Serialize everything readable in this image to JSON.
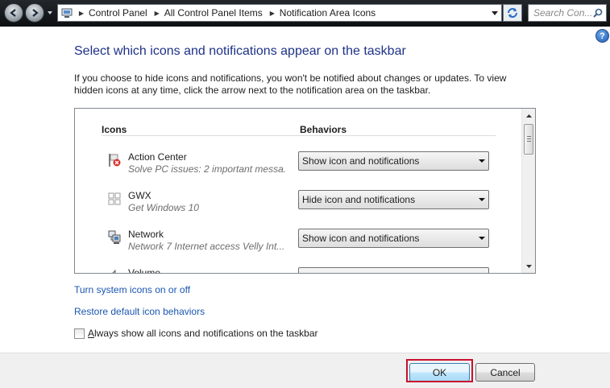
{
  "address_bar": {
    "breadcrumbs": [
      "Control Panel",
      "All Control Panel Items",
      "Notification Area Icons"
    ],
    "search_placeholder": "Search Con...",
    "icons": [
      "back-arrow-icon",
      "forward-arrow-icon",
      "control-panel-icon",
      "refresh-icon",
      "search-icon"
    ]
  },
  "help_label": "?",
  "page": {
    "title": "Select which icons and notifications appear on the taskbar",
    "description": "If you choose to hide icons and notifications, you won't be notified about changes or updates. To view hidden icons at any time, click the arrow next to the notification area on the taskbar."
  },
  "list": {
    "col_icons": "Icons",
    "col_behaviors": "Behaviors",
    "rows": [
      {
        "name": "Action Center",
        "subtitle": "Solve PC issues: 2 important messa...",
        "behavior": "Show icon and notifications",
        "icon": "action-center-flag-icon"
      },
      {
        "name": "GWX",
        "subtitle": "Get Windows 10",
        "behavior": "Hide icon and notifications",
        "icon": "windows-logo-icon"
      },
      {
        "name": "Network",
        "subtitle": "Network  7 Internet access Velly Int...",
        "behavior": "Show icon and notifications",
        "icon": "network-icon"
      },
      {
        "name": "Volume",
        "subtitle": "",
        "behavior": "",
        "icon": "speaker-icon"
      }
    ]
  },
  "links": {
    "system_icons": "Turn system icons on or off",
    "restore": "Restore default icon behaviors"
  },
  "checkbox": {
    "label_first": "A",
    "label_rest": "lways show all icons and notifications on the taskbar",
    "checked": false
  },
  "buttons": {
    "ok": "OK",
    "cancel": "Cancel"
  },
  "colors": {
    "title": "#1e3287",
    "link": "#1b56b1",
    "highlight": "#c8102e"
  }
}
